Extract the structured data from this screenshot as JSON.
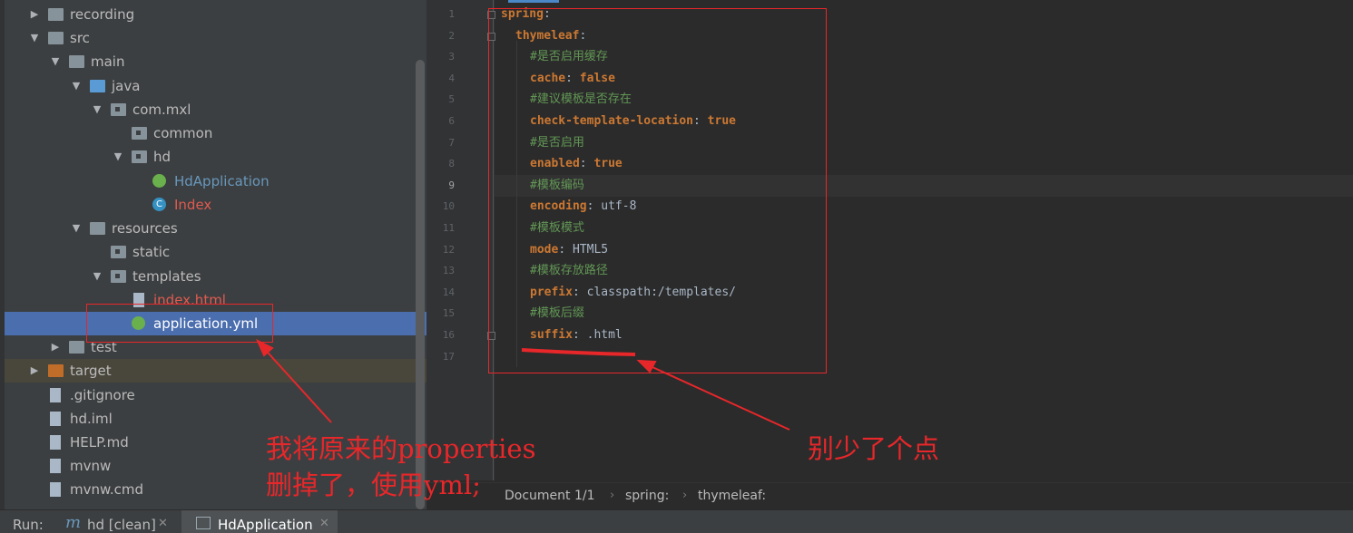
{
  "project_tree": {
    "items": [
      {
        "label": "recording",
        "icon": "folder-icon",
        "expanded": false,
        "color": "default"
      },
      {
        "label": "src",
        "icon": "folder-icon",
        "expanded": true,
        "color": "default"
      },
      {
        "label": "main",
        "icon": "folder-icon",
        "expanded": true,
        "color": "default"
      },
      {
        "label": "java",
        "icon": "source-folder-icon",
        "expanded": true,
        "color": "default"
      },
      {
        "label": "com.mxl",
        "icon": "package-icon",
        "expanded": true,
        "color": "default"
      },
      {
        "label": "common",
        "icon": "package-icon",
        "expanded": null,
        "color": "default"
      },
      {
        "label": "hd",
        "icon": "package-icon",
        "expanded": true,
        "color": "default"
      },
      {
        "label": "HdApplication",
        "icon": "spring-boot-class-icon",
        "expanded": null,
        "color": "blue"
      },
      {
        "label": "Index",
        "icon": "class-icon",
        "expanded": null,
        "color": "red"
      },
      {
        "label": "resources",
        "icon": "resources-folder-icon",
        "expanded": true,
        "color": "default"
      },
      {
        "label": "static",
        "icon": "package-icon",
        "expanded": null,
        "color": "default"
      },
      {
        "label": "templates",
        "icon": "package-icon",
        "expanded": true,
        "color": "default"
      },
      {
        "label": "index.html",
        "icon": "html-file-icon",
        "expanded": null,
        "color": "red"
      },
      {
        "label": "application.yml",
        "icon": "spring-yml-icon",
        "expanded": null,
        "color": "white",
        "selected": true
      },
      {
        "label": "test",
        "icon": "folder-icon",
        "expanded": false,
        "color": "default"
      },
      {
        "label": "target",
        "icon": "excluded-folder-icon",
        "expanded": false,
        "color": "default",
        "excluded": true
      },
      {
        "label": ".gitignore",
        "icon": "text-file-icon",
        "expanded": null,
        "color": "default"
      },
      {
        "label": "hd.iml",
        "icon": "iml-file-icon",
        "expanded": null,
        "color": "default"
      },
      {
        "label": "HELP.md",
        "icon": "markdown-file-icon",
        "expanded": null,
        "color": "default"
      },
      {
        "label": "mvnw",
        "icon": "text-file-icon",
        "expanded": null,
        "color": "default"
      },
      {
        "label": "mvnw.cmd",
        "icon": "text-file-icon",
        "expanded": null,
        "color": "default"
      }
    ]
  },
  "editor": {
    "current_line": 9,
    "lines": [
      {
        "n": "1",
        "indent": 0,
        "key": "spring",
        "sep": ":",
        "val": ""
      },
      {
        "n": "2",
        "indent": 1,
        "key": "thymeleaf",
        "sep": ":",
        "val": ""
      },
      {
        "n": "3",
        "indent": 2,
        "comment": "#是否启用缓存"
      },
      {
        "n": "4",
        "indent": 2,
        "key": "cache",
        "sep": ": ",
        "val": "false",
        "bool": true
      },
      {
        "n": "5",
        "indent": 2,
        "comment": "#建议模板是否存在"
      },
      {
        "n": "6",
        "indent": 2,
        "key": "check-template-location",
        "sep": ": ",
        "val": "true",
        "bool": true
      },
      {
        "n": "7",
        "indent": 2,
        "comment": "#是否启用"
      },
      {
        "n": "8",
        "indent": 2,
        "key": "enabled",
        "sep": ": ",
        "val": "true",
        "bool": true
      },
      {
        "n": "9",
        "indent": 2,
        "comment": "#模板编码"
      },
      {
        "n": "10",
        "indent": 2,
        "key": "encoding",
        "sep": ": ",
        "val": "utf-8"
      },
      {
        "n": "11",
        "indent": 2,
        "comment": "#模板模式"
      },
      {
        "n": "12",
        "indent": 2,
        "key": "mode",
        "sep": ": ",
        "val": "HTML5"
      },
      {
        "n": "13",
        "indent": 2,
        "comment": "#模板存放路径"
      },
      {
        "n": "14",
        "indent": 2,
        "key": "prefix",
        "sep": ": ",
        "val": "classpath:/templates/"
      },
      {
        "n": "15",
        "indent": 2,
        "comment": "#模板后缀"
      },
      {
        "n": "16",
        "indent": 2,
        "key": "suffix",
        "sep": ": ",
        "val": ".html"
      },
      {
        "n": "17",
        "indent": 0,
        "key": "",
        "sep": "",
        "val": ""
      }
    ]
  },
  "breadcrumb": {
    "document": "Document 1/1",
    "path": [
      "spring:",
      "thymeleaf:"
    ]
  },
  "run_bar": {
    "label": "Run:",
    "tabs": [
      {
        "label": "hd [clean]",
        "icon": "maven-icon"
      },
      {
        "label": "HdApplication",
        "icon": "application-icon",
        "active": true
      }
    ]
  },
  "annotations": {
    "left_note_line1": "我将原来的properties",
    "left_note_line2": "删掉了，使用yml;",
    "right_note": "别少了个点",
    "color": "#e8272a"
  },
  "colors": {
    "selection": "#4b6eaf",
    "keyword": "#cc7832",
    "comment": "#629755",
    "annotation": "#e8272a"
  }
}
